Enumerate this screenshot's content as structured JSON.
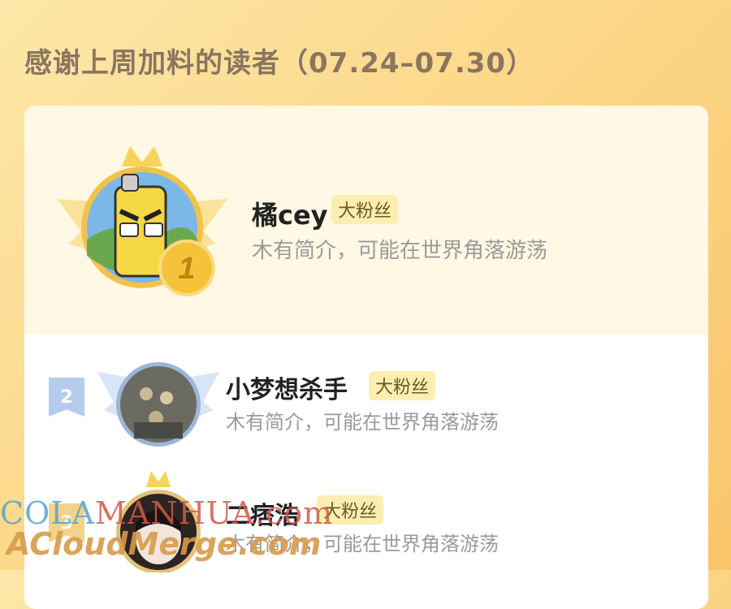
{
  "header": {
    "title": "感谢上周加料的读者（07.24–07.30）"
  },
  "colors": {
    "background": "#fcd88a",
    "tag": "#fbeeb0",
    "rank1_gold": "#f2b833",
    "rank2_blue": "#b6ccec"
  },
  "readers": [
    {
      "rank": "1",
      "name": "橘cey",
      "tag": "大粉丝",
      "bio": "木有简介，可能在世界角落游荡"
    },
    {
      "rank": "2",
      "name": "小梦想杀手",
      "tag": "大粉丝",
      "bio": "木有简介，可能在世界角落游荡"
    },
    {
      "rank": "3",
      "name": "二痞浩",
      "tag": "大粉丝",
      "bio": "木有简介，可能在世界角落游荡"
    }
  ],
  "watermarks": {
    "line1_left": "COLA",
    "line1_right": "MANHUA.com",
    "line2": "ACloudMerge.com"
  }
}
